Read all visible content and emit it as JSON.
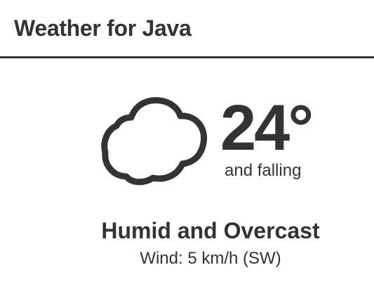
{
  "header": {
    "title": "Weather for Java"
  },
  "current": {
    "icon": "cloud-icon",
    "temperature": "24°",
    "trend": "and falling",
    "condition": "Humid and Overcast",
    "wind_label": "Wind:",
    "wind_value": "5 km/h (SW)"
  },
  "colors": {
    "text": "#333333",
    "background": "#ffffff",
    "divider": "#333333"
  }
}
